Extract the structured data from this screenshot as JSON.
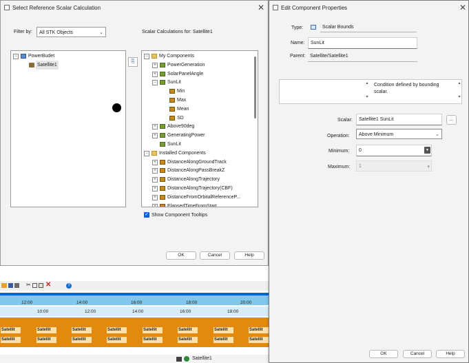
{
  "select_dialog": {
    "title": "Select Reference Scalar Calculation",
    "filter_label": "Filter by:",
    "filter_value": "All STK Objects",
    "calc_header": "Scalar Calculations for: Satellite1",
    "objects_tree": [
      {
        "label": "PowerBudet"
      },
      {
        "label": "Satellite1"
      }
    ],
    "calc_tree": [
      {
        "label": "My Components",
        "kind": "folder",
        "expander": "−"
      },
      {
        "label": "PowerGeneration",
        "kind": "calc",
        "expander": "+"
      },
      {
        "label": "SolarPanelAngle",
        "kind": "calc",
        "expander": "+"
      },
      {
        "label": "SunLit",
        "kind": "calc",
        "expander": "−"
      },
      {
        "label": "Min",
        "kind": "bar",
        "expander": ""
      },
      {
        "label": "Max",
        "kind": "bar",
        "expander": ""
      },
      {
        "label": "Mean",
        "kind": "bar",
        "expander": ""
      },
      {
        "label": "SD",
        "kind": "bar",
        "expander": ""
      },
      {
        "label": "Above90deg",
        "kind": "calc",
        "expander": "+"
      },
      {
        "label": "GeneratingPower",
        "kind": "calc",
        "expander": "+"
      },
      {
        "label": "SunLit",
        "kind": "calc",
        "expander": ""
      },
      {
        "label": "Installed Components",
        "kind": "folder",
        "expander": "−"
      },
      {
        "label": "DistanceAlongGroundTrack",
        "kind": "bar",
        "expander": "+"
      },
      {
        "label": "DistanceAlongPassBreakZ",
        "kind": "bar",
        "expander": "+"
      },
      {
        "label": "DistanceAlongTrajectory",
        "kind": "bar",
        "expander": "+"
      },
      {
        "label": "DistanceAlongTrajectory(CBF)",
        "kind": "bar",
        "expander": "+"
      },
      {
        "label": "DistanceFromOrbitalReferenceP...",
        "kind": "bar",
        "expander": "+"
      },
      {
        "label": "ElapsedTimeFromStart",
        "kind": "bar",
        "expander": "+"
      }
    ],
    "show_tooltips_label": "Show Component Tooltips",
    "show_tooltips_checked": true,
    "ok_label": "OK",
    "cancel_label": "Cancel",
    "help_label": "Help"
  },
  "edit_dialog": {
    "title": "Edit Component Properties",
    "type_label": "Type:",
    "type_value": "Scalar Bounds",
    "name_label": "Name:",
    "name_value": "SunLit",
    "parent_label": "Parent:",
    "parent_value": "Satellite/Satellite1",
    "description": "Condition defined by bounding scalar.",
    "scalar_label": "Scalar:",
    "scalar_value": "Satellite1 SunLit",
    "browse_label": "...",
    "operation_label": "Operation:",
    "operation_value": "Above Minimum",
    "minimum_label": "Minimum:",
    "minimum_value": "0",
    "maximum_label": "Maximum:",
    "maximum_value": "1",
    "ok_label": "OK",
    "cancel_label": "Cancel",
    "help_label": "Help"
  },
  "timeline": {
    "top_ticks": [
      "12:00",
      "14:00",
      "16:00",
      "18:00",
      "20:00"
    ],
    "bottom_ticks": [
      "10:00",
      "12:00",
      "14:00",
      "16:00",
      "18:00"
    ],
    "segment_label": "Satellit",
    "footer_label": "Satellite1"
  },
  "colors": {
    "accent_blue": "#0a64d8",
    "timeline_orange": "#e28a0e",
    "timeline_blue": "#7fc8ec"
  }
}
